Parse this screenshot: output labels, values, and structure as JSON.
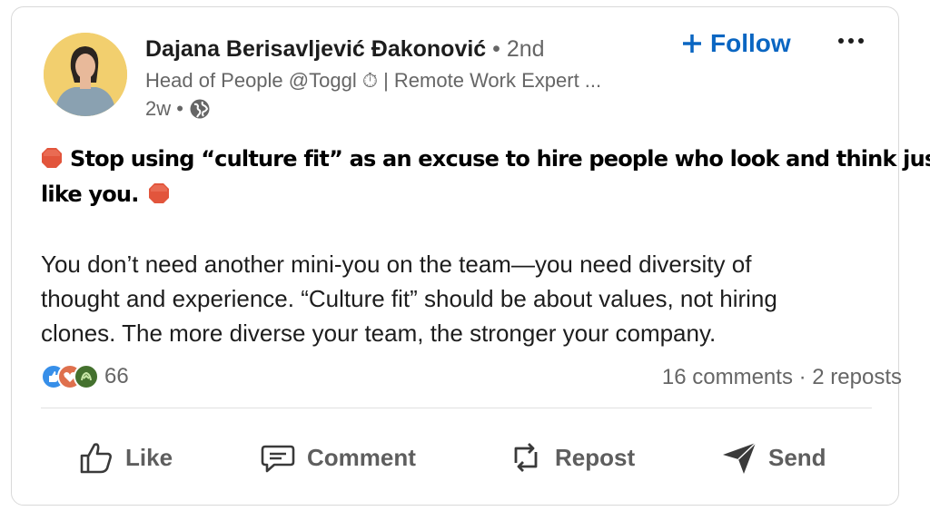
{
  "post": {
    "author": {
      "name": "Dajana Berisavljević Đakonović",
      "degree": "• 2nd",
      "headline": "Head of People @Toggl ⏱ | Remote Work Expert ...",
      "time": "2w •"
    },
    "follow_label": "Follow",
    "text": {
      "bold_line1": "Stop using “culture fit” as an excuse to hire people who look and think just",
      "bold_line2": "like you.",
      "body_line1": "You don’t need another mini-you on the team—you need diversity of",
      "body_line2": "thought and experience. “Culture fit” should be about values, not hiring",
      "body_line3": "clones. The more diverse your team, the stronger your company."
    },
    "reactions": {
      "count": "66",
      "comments_reposts": "16 comments · 2 reposts"
    },
    "actions": {
      "like": "Like",
      "comment": "Comment",
      "repost": "Repost",
      "send": "Send"
    }
  },
  "colors": {
    "accent": "#0a66c2",
    "stop_sign": "#e2553c",
    "muted_text": "#666666",
    "avatar_bg": "#f2cf6e"
  },
  "icons": {
    "follow": "plus-icon",
    "more": "ellipsis-icon",
    "visibility": "globe-icon",
    "emoji": "stop-sign-icon",
    "like": "thumbs-up-icon",
    "comment": "comment-icon",
    "repost": "repost-icon",
    "send": "send-icon"
  }
}
